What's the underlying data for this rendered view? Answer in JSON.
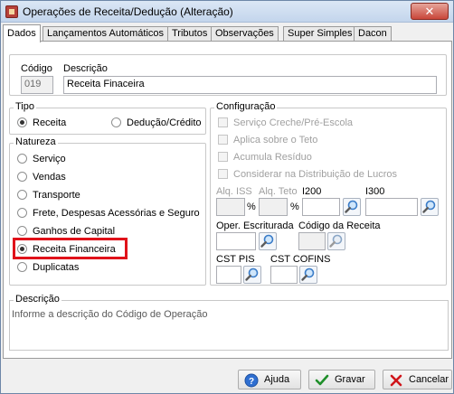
{
  "window": {
    "title": "Operações de Receita/Dedução (Alteração)",
    "close_glyph": "✕"
  },
  "tabs": [
    {
      "label": "Dados"
    },
    {
      "label": "Lançamentos Automáticos"
    },
    {
      "label": "Tributos"
    },
    {
      "label": "Observações"
    },
    {
      "label": "Super Simples"
    },
    {
      "label": "Dacon"
    }
  ],
  "header": {
    "codigo_label": "Código",
    "codigo_value": "019",
    "descricao_label": "Descrição",
    "descricao_value": "Receita Finaceira"
  },
  "tipo": {
    "label": "Tipo",
    "options": [
      {
        "label": "Receita",
        "selected": true
      },
      {
        "label": "Dedução/Crédito",
        "selected": false
      }
    ]
  },
  "natureza": {
    "label": "Natureza",
    "options": [
      {
        "label": "Serviço",
        "selected": false
      },
      {
        "label": "Vendas",
        "selected": false
      },
      {
        "label": "Transporte",
        "selected": false
      },
      {
        "label": "Frete, Despesas Acessórias e Seguro",
        "selected": false
      },
      {
        "label": "Ganhos de Capital",
        "selected": false
      },
      {
        "label": "Receita Financeira",
        "selected": true
      },
      {
        "label": "Duplicatas",
        "selected": false
      }
    ]
  },
  "configuracao": {
    "label": "Configuração",
    "checks": [
      {
        "label": "Serviço Creche/Pré-Escola",
        "checked": false
      },
      {
        "label": "Aplica sobre o Teto",
        "checked": false
      },
      {
        "label": "Acumula Resíduo",
        "checked": false
      },
      {
        "label": "Considerar na Distribuição de Lucros",
        "checked": false
      }
    ],
    "alq_iss_label": "Alq. ISS",
    "alq_teto_label": "Alq. Teto",
    "percent": "%",
    "i200_label": "I200",
    "i300_label": "I300",
    "oper_escriturada_label": "Oper. Escriturada",
    "codigo_receita_label": "Código da Receita",
    "cst_pis_label": "CST PIS",
    "cst_cofins_label": "CST COFINS"
  },
  "descricao_info": {
    "label": "Descrição",
    "text": "Informe a descrição do Código de Operação"
  },
  "buttons": {
    "ajuda": "Ajuda",
    "gravar": "Gravar",
    "cancelar": "Cancelar"
  }
}
